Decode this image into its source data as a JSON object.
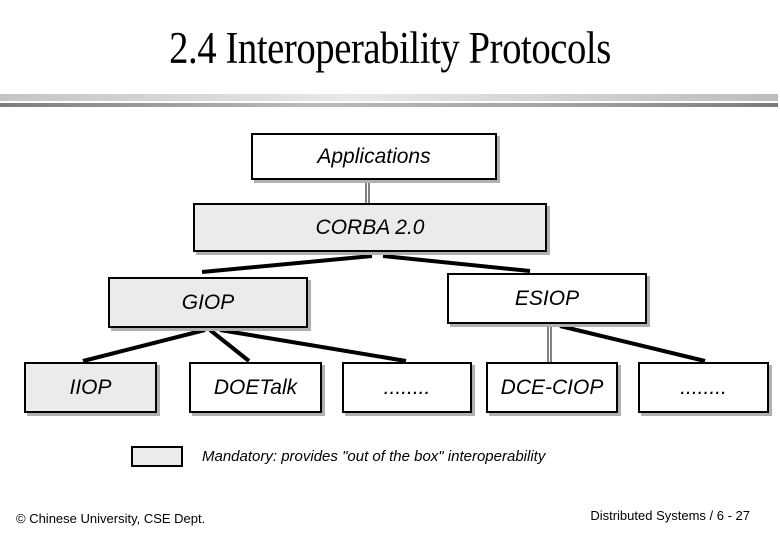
{
  "slide": {
    "title": "2.4 Interoperability Protocols",
    "footer_left": "© Chinese University, CSE Dept.",
    "footer_right": "Distributed Systems / 6 - 27"
  },
  "colors": {
    "mandatory_fill": "#ebebeb",
    "optional_fill": "#ffffff",
    "border": "#000000",
    "shadow": "#b0b0b0"
  },
  "diagram": {
    "nodes": {
      "applications": {
        "label": "Applications",
        "mandatory": false
      },
      "corba": {
        "label": "CORBA 2.0",
        "mandatory": true
      },
      "giop": {
        "label": "GIOP",
        "mandatory": true
      },
      "esiop": {
        "label": "ESIOP",
        "mandatory": false
      },
      "iiop": {
        "label": "IIOP",
        "mandatory": true
      },
      "doetalk": {
        "label": "DOETalk",
        "mandatory": false
      },
      "giop_other": {
        "label": "........",
        "mandatory": false
      },
      "dce_ciop": {
        "label": "DCE-CIOP",
        "mandatory": false
      },
      "esiop_other": {
        "label": "........",
        "mandatory": false
      }
    },
    "edges": [
      {
        "from": "applications",
        "to": "corba",
        "style": "double"
      },
      {
        "from": "corba",
        "to": "giop",
        "style": "thick"
      },
      {
        "from": "corba",
        "to": "esiop",
        "style": "thick"
      },
      {
        "from": "giop",
        "to": "iiop",
        "style": "thick"
      },
      {
        "from": "giop",
        "to": "doetalk",
        "style": "thick"
      },
      {
        "from": "giop",
        "to": "giop_other",
        "style": "thick"
      },
      {
        "from": "esiop",
        "to": "dce_ciop",
        "style": "double"
      },
      {
        "from": "esiop",
        "to": "esiop_other",
        "style": "thick"
      }
    ]
  },
  "legend": {
    "text": "Mandatory: provides \"out of the box\" interoperability"
  }
}
